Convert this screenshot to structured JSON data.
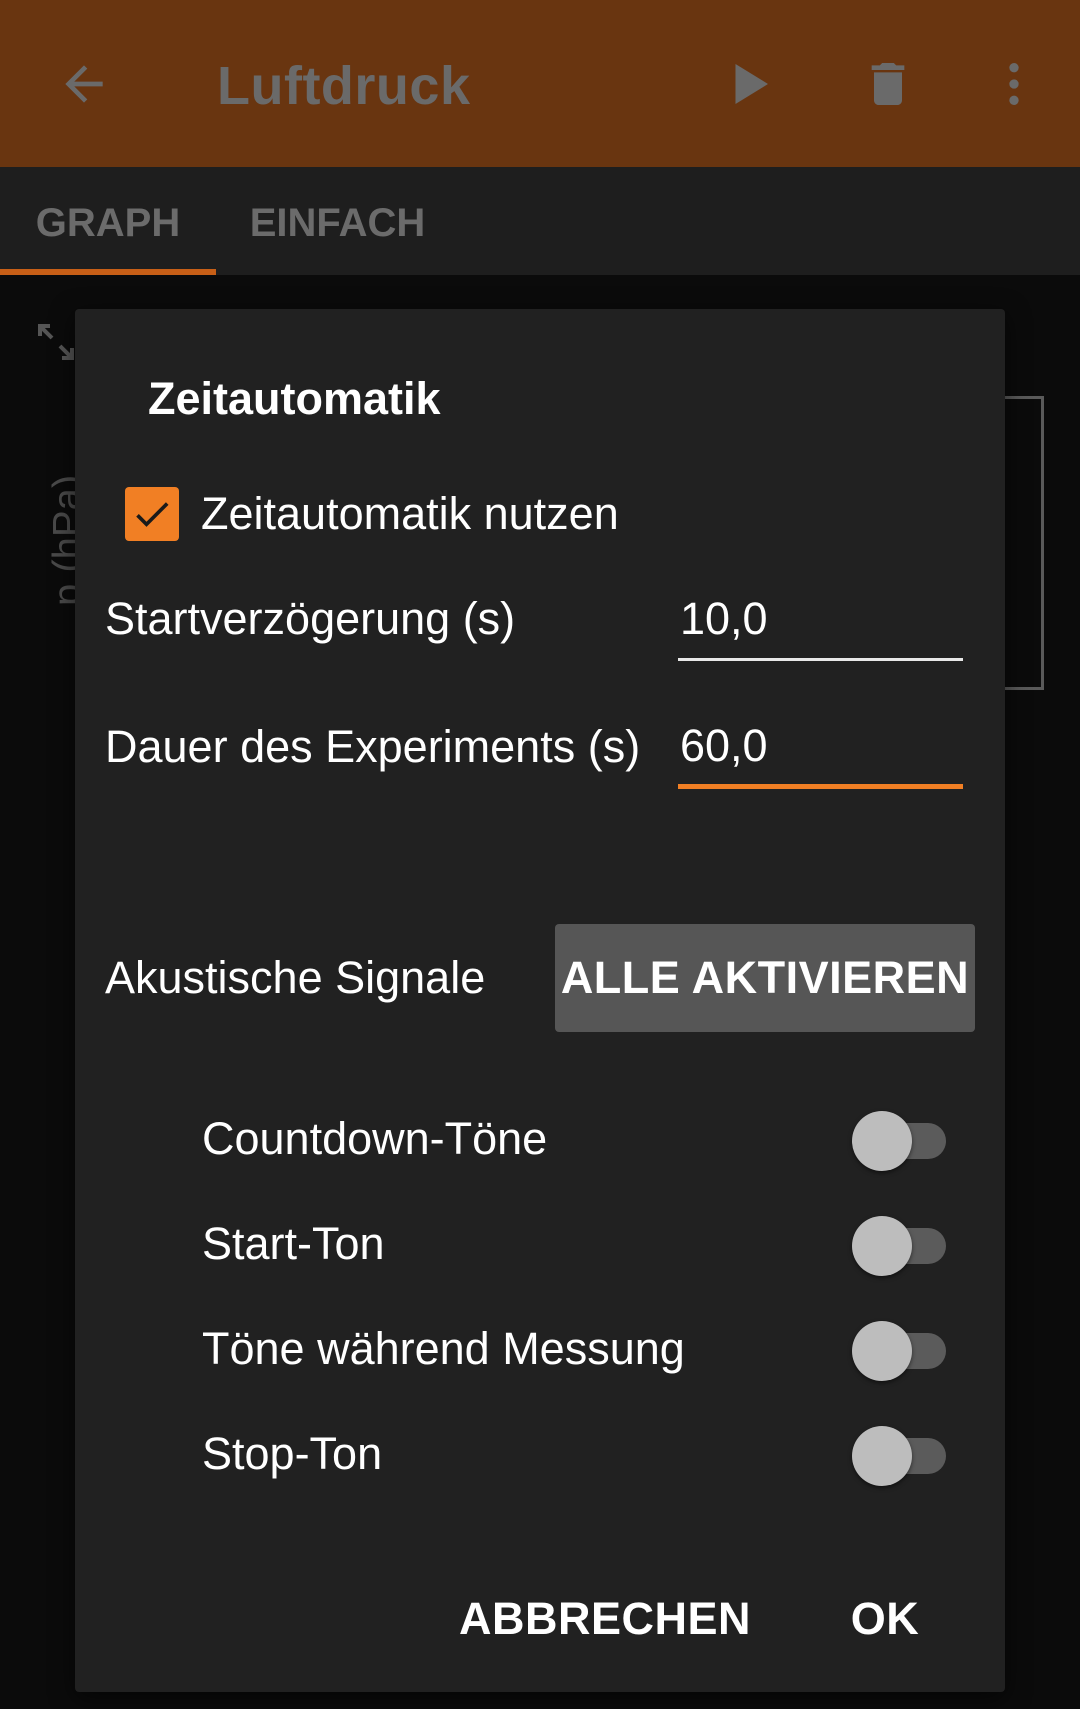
{
  "toolbar": {
    "title": "Luftdruck",
    "icons": [
      "arrow-back-icon",
      "play-icon",
      "trash-icon",
      "more-vert-icon"
    ],
    "background_color": "#693510"
  },
  "tabs": [
    {
      "label": "GRAPH",
      "selected": true
    },
    {
      "label": "EINFACH",
      "selected": false
    }
  ],
  "graph": {
    "axis_label": "p (hPa)"
  },
  "dialog": {
    "title": "Zeitautomatik",
    "use_checkbox": {
      "label": "Zeitautomatik nutzen",
      "checked": true
    },
    "start_delay": {
      "label": "Startverzögerung (s)",
      "value": "10,0"
    },
    "duration": {
      "label": "Dauer des Experiments (s)",
      "value": "60,0"
    },
    "signals": {
      "label": "Akustische Signale",
      "enable_all_label": "ALLE AKTIVIEREN",
      "toggles": [
        {
          "label": "Countdown-Töne",
          "on": false
        },
        {
          "label": "Start-Ton",
          "on": false
        },
        {
          "label": "Töne während Messung",
          "on": false
        },
        {
          "label": "Stop-Ton",
          "on": false
        }
      ]
    },
    "cancel_label": "ABBRECHEN",
    "ok_label": "OK"
  },
  "colors": {
    "accent": "#f17f24",
    "dialog_background": "#212121",
    "tab_indicator": "#c75f17"
  }
}
